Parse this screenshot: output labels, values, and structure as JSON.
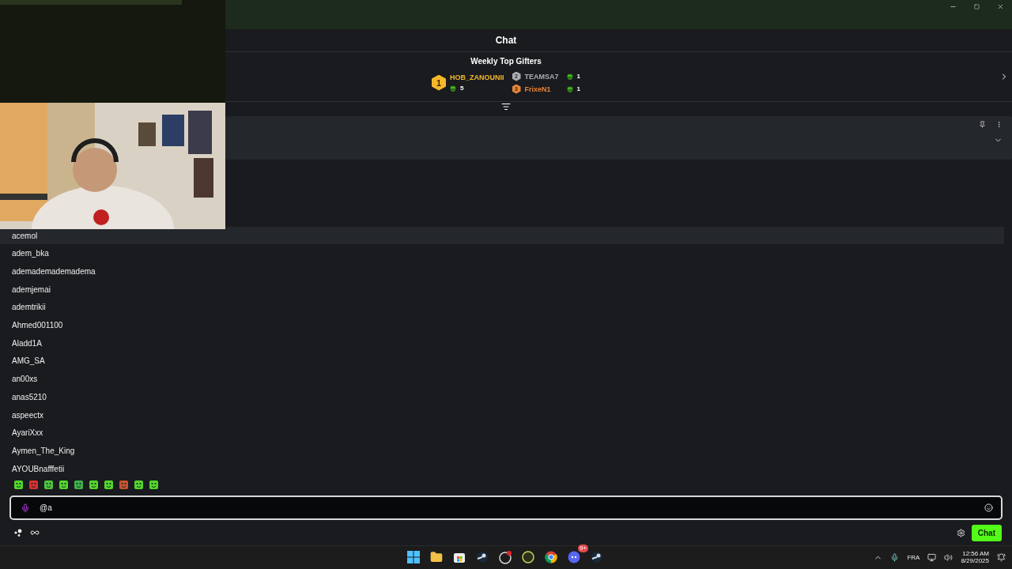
{
  "chat": {
    "title": "Chat"
  },
  "gifters": {
    "title": "Weekly Top Gifters",
    "entries": [
      {
        "rank": "1",
        "name": "HOB_ZANOUNII",
        "count": "5",
        "color": "#f5b72b"
      },
      {
        "rank": "2",
        "name": "TEAMSA7",
        "count": "1",
        "color": "#a9adb3"
      },
      {
        "rank": "3",
        "name": "FrixeN1",
        "count": "1",
        "color": "#e8843a"
      }
    ]
  },
  "suggestions": [
    {
      "name": "acemol",
      "selected": true
    },
    {
      "name": "adem_bka",
      "selected": false
    },
    {
      "name": "ademademademadema",
      "selected": false
    },
    {
      "name": "ademjemai",
      "selected": false
    },
    {
      "name": "ademtrikii",
      "selected": false
    },
    {
      "name": "Ahmed001100",
      "selected": false
    },
    {
      "name": "Aladd1A",
      "selected": false
    },
    {
      "name": "AMG_SA",
      "selected": false
    },
    {
      "name": "an00xs",
      "selected": false
    },
    {
      "name": "anas5210",
      "selected": false
    },
    {
      "name": "aspeectx",
      "selected": false
    },
    {
      "name": "AyariXxx",
      "selected": false
    },
    {
      "name": "Aymen_The_King",
      "selected": false
    },
    {
      "name": "AYOUBnafffetii",
      "selected": false
    }
  ],
  "emotes": [
    {
      "color": "#53d62a"
    },
    {
      "color": "#d8322e"
    },
    {
      "color": "#4fc43a"
    },
    {
      "color": "#53d62a"
    },
    {
      "color": "#3fb24a"
    },
    {
      "color": "#53d62a"
    },
    {
      "color": "#53d62a"
    },
    {
      "color": "#c9532e"
    },
    {
      "color": "#53d62a"
    },
    {
      "color": "#53d62a"
    }
  ],
  "input": {
    "value": "@a"
  },
  "send_button": "Chat",
  "taskbar": {
    "discord_badge": "9+",
    "language": "FRA",
    "time": "12:56 AM",
    "date": "8/29/2025"
  }
}
